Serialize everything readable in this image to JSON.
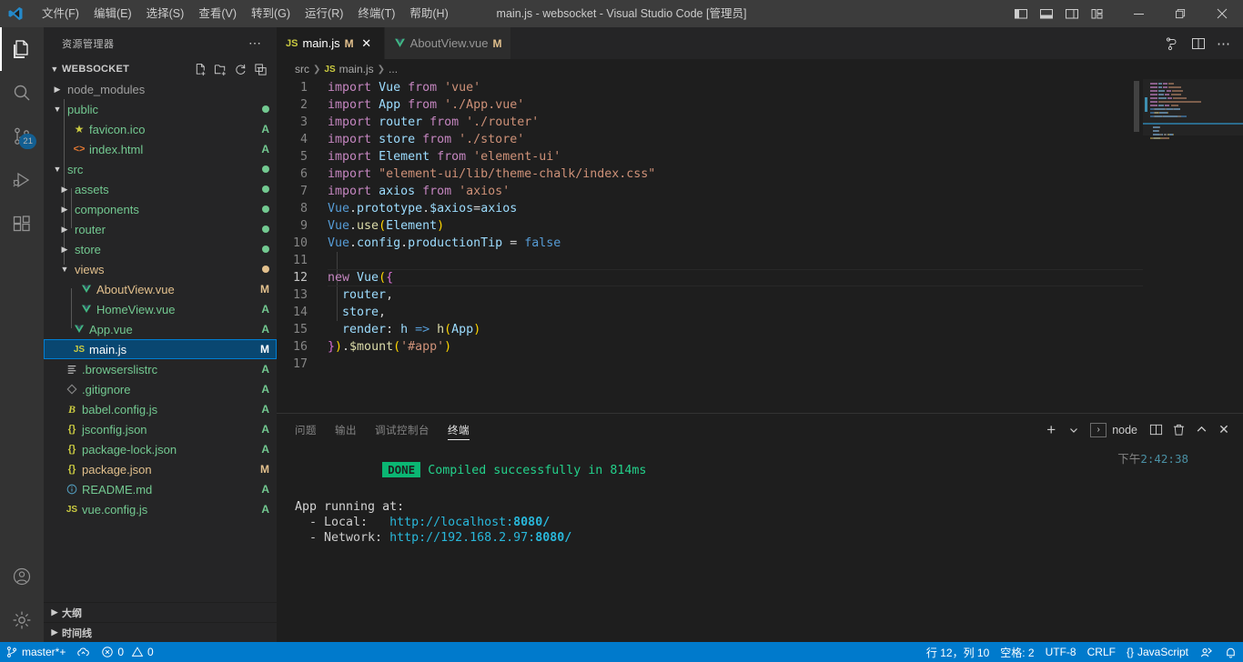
{
  "titlebar": {
    "window_title": "main.js - websocket - Visual Studio Code [管理员]",
    "menu": [
      {
        "label": "文件(F)",
        "name": "menu-file"
      },
      {
        "label": "编辑(E)",
        "name": "menu-edit"
      },
      {
        "label": "选择(S)",
        "name": "menu-selection"
      },
      {
        "label": "查看(V)",
        "name": "menu-view"
      },
      {
        "label": "转到(G)",
        "name": "menu-go"
      },
      {
        "label": "运行(R)",
        "name": "menu-run"
      },
      {
        "label": "终端(T)",
        "name": "menu-terminal"
      },
      {
        "label": "帮助(H)",
        "name": "menu-help"
      }
    ],
    "window_controls": {
      "minimize": "—",
      "maximize": "❐",
      "close": "✕"
    }
  },
  "activitybar": {
    "items": [
      {
        "name": "explorer",
        "icon": "files-icon",
        "active": true,
        "badge": ""
      },
      {
        "name": "search",
        "icon": "search-icon",
        "active": false,
        "badge": ""
      },
      {
        "name": "source-control",
        "icon": "source-control-icon",
        "active": false,
        "badge": "21"
      },
      {
        "name": "run-debug",
        "icon": "run-debug-icon",
        "active": false,
        "badge": ""
      },
      {
        "name": "extensions",
        "icon": "extensions-icon",
        "active": false,
        "badge": ""
      }
    ],
    "bottom": [
      {
        "name": "account",
        "icon": "account-icon"
      },
      {
        "name": "settings",
        "icon": "gear-icon"
      }
    ]
  },
  "sidebar": {
    "title": "资源管理器",
    "more_label": "⋯",
    "project": {
      "name": "WEBSOCKET",
      "actions": [
        "new-file-icon",
        "new-folder-icon",
        "refresh-icon",
        "collapse-all-icon"
      ]
    },
    "files": [
      {
        "label": "node_modules",
        "type": "folder",
        "expanded": false,
        "depth": 0,
        "status": "",
        "color": "grey"
      },
      {
        "label": "public",
        "type": "folder",
        "expanded": true,
        "depth": 0,
        "status": "",
        "color": "green",
        "dot": "#73c991"
      },
      {
        "label": "favicon.ico",
        "type": "file",
        "icon": "star-icon",
        "depth": 1,
        "status": "A",
        "color": "green"
      },
      {
        "label": "index.html",
        "type": "file",
        "icon": "html-icon",
        "depth": 1,
        "status": "A",
        "color": "green"
      },
      {
        "label": "src",
        "type": "folder",
        "expanded": true,
        "depth": 0,
        "status": "",
        "color": "green",
        "dot": "#73c991"
      },
      {
        "label": "assets",
        "type": "folder",
        "expanded": false,
        "depth": 1,
        "status": "",
        "color": "green",
        "dot": "#73c991"
      },
      {
        "label": "components",
        "type": "folder",
        "expanded": false,
        "depth": 1,
        "status": "",
        "color": "green",
        "dot": "#73c991"
      },
      {
        "label": "router",
        "type": "folder",
        "expanded": false,
        "depth": 1,
        "status": "",
        "color": "green",
        "dot": "#73c991"
      },
      {
        "label": "store",
        "type": "folder",
        "expanded": false,
        "depth": 1,
        "status": "",
        "color": "green",
        "dot": "#73c991"
      },
      {
        "label": "views",
        "type": "folder",
        "expanded": true,
        "depth": 1,
        "status": "",
        "color": "orange",
        "dot": "#e2c08d"
      },
      {
        "label": "AboutView.vue",
        "type": "file",
        "icon": "vue-icon",
        "depth": 2,
        "status": "M",
        "color": "orange"
      },
      {
        "label": "HomeView.vue",
        "type": "file",
        "icon": "vue-icon",
        "depth": 2,
        "status": "A",
        "color": "green"
      },
      {
        "label": "App.vue",
        "type": "file",
        "icon": "vue-icon",
        "depth": 1,
        "status": "A",
        "color": "green"
      },
      {
        "label": "main.js",
        "type": "file",
        "icon": "js-icon",
        "depth": 1,
        "status": "M",
        "color": "selected",
        "selected": true
      },
      {
        "label": ".browserslistrc",
        "type": "file",
        "icon": "list-icon",
        "depth": 0,
        "status": "A",
        "color": "green"
      },
      {
        "label": ".gitignore",
        "type": "file",
        "icon": "git-icon",
        "depth": 0,
        "status": "A",
        "color": "green"
      },
      {
        "label": "babel.config.js",
        "type": "file",
        "icon": "babel-icon",
        "depth": 0,
        "status": "A",
        "color": "green"
      },
      {
        "label": "jsconfig.json",
        "type": "file",
        "icon": "json-icon",
        "depth": 0,
        "status": "A",
        "color": "green"
      },
      {
        "label": "package-lock.json",
        "type": "file",
        "icon": "json-icon",
        "depth": 0,
        "status": "A",
        "color": "green"
      },
      {
        "label": "package.json",
        "type": "file",
        "icon": "json-icon",
        "depth": 0,
        "status": "M",
        "color": "orange"
      },
      {
        "label": "README.md",
        "type": "file",
        "icon": "info-icon",
        "depth": 0,
        "status": "A",
        "color": "green"
      },
      {
        "label": "vue.config.js",
        "type": "file",
        "icon": "js-icon",
        "depth": 0,
        "status": "A",
        "color": "green"
      }
    ],
    "sections": [
      {
        "label": "大纲",
        "name": "outline-section"
      },
      {
        "label": "时间线",
        "name": "timeline-section"
      }
    ]
  },
  "editor": {
    "tabs": [
      {
        "label": "main.js",
        "icon": "JS",
        "dirty": "M",
        "active": true,
        "close": "✕"
      },
      {
        "label": "AboutView.vue",
        "icon": "V",
        "dirty": "M",
        "active": false,
        "close": ""
      }
    ],
    "actions": [
      "split-vertical-icon",
      "split-editor-icon",
      "more-actions-icon"
    ],
    "breadcrumbs": [
      "src",
      "main.js",
      "..."
    ],
    "lines": [
      {
        "n": "1",
        "tokens": [
          [
            "tok-kw",
            "import"
          ],
          [
            "tok-plain",
            " "
          ],
          [
            "tok-id",
            "Vue"
          ],
          [
            "tok-plain",
            " "
          ],
          [
            "tok-kw",
            "from"
          ],
          [
            "tok-plain",
            " "
          ],
          [
            "tok-str",
            "'vue'"
          ]
        ]
      },
      {
        "n": "2",
        "tokens": [
          [
            "tok-kw",
            "import"
          ],
          [
            "tok-plain",
            " "
          ],
          [
            "tok-id",
            "App"
          ],
          [
            "tok-plain",
            " "
          ],
          [
            "tok-kw",
            "from"
          ],
          [
            "tok-plain",
            " "
          ],
          [
            "tok-str",
            "'./App.vue'"
          ]
        ]
      },
      {
        "n": "3",
        "tokens": [
          [
            "tok-kw",
            "import"
          ],
          [
            "tok-plain",
            " "
          ],
          [
            "tok-id",
            "router"
          ],
          [
            "tok-plain",
            " "
          ],
          [
            "tok-kw",
            "from"
          ],
          [
            "tok-plain",
            " "
          ],
          [
            "tok-str",
            "'./router'"
          ]
        ]
      },
      {
        "n": "4",
        "tokens": [
          [
            "tok-kw",
            "import"
          ],
          [
            "tok-plain",
            " "
          ],
          [
            "tok-id",
            "store"
          ],
          [
            "tok-plain",
            " "
          ],
          [
            "tok-kw",
            "from"
          ],
          [
            "tok-plain",
            " "
          ],
          [
            "tok-str",
            "'./store'"
          ]
        ]
      },
      {
        "n": "5",
        "tokens": [
          [
            "tok-kw",
            "import"
          ],
          [
            "tok-plain",
            " "
          ],
          [
            "tok-id",
            "Element"
          ],
          [
            "tok-plain",
            " "
          ],
          [
            "tok-kw",
            "from"
          ],
          [
            "tok-plain",
            " "
          ],
          [
            "tok-str",
            "'element-ui'"
          ]
        ]
      },
      {
        "n": "6",
        "tokens": [
          [
            "tok-kw",
            "import"
          ],
          [
            "tok-plain",
            " "
          ],
          [
            "tok-str",
            "\"element-ui/lib/theme-chalk/index.css\""
          ]
        ]
      },
      {
        "n": "7",
        "tokens": [
          [
            "tok-kw",
            "import"
          ],
          [
            "tok-plain",
            " "
          ],
          [
            "tok-id",
            "axios"
          ],
          [
            "tok-plain",
            " "
          ],
          [
            "tok-kw",
            "from"
          ],
          [
            "tok-plain",
            " "
          ],
          [
            "tok-str",
            "'axios'"
          ]
        ]
      },
      {
        "n": "8",
        "tokens": [
          [
            "tok-const",
            "Vue"
          ],
          [
            "tok-plain",
            "."
          ],
          [
            "tok-id",
            "prototype"
          ],
          [
            "tok-plain",
            "."
          ],
          [
            "tok-id",
            "$axios"
          ],
          [
            "tok-plain",
            "="
          ],
          [
            "tok-id",
            "axios"
          ]
        ]
      },
      {
        "n": "9",
        "tokens": [
          [
            "tok-const",
            "Vue"
          ],
          [
            "tok-plain",
            "."
          ],
          [
            "tok-fn",
            "use"
          ],
          [
            "tok-br1",
            "("
          ],
          [
            "tok-id",
            "Element"
          ],
          [
            "tok-br1",
            ")"
          ]
        ]
      },
      {
        "n": "10",
        "tokens": [
          [
            "tok-const",
            "Vue"
          ],
          [
            "tok-plain",
            "."
          ],
          [
            "tok-id",
            "config"
          ],
          [
            "tok-plain",
            "."
          ],
          [
            "tok-id",
            "productionTip"
          ],
          [
            "tok-plain",
            " = "
          ],
          [
            "tok-const",
            "false"
          ]
        ]
      },
      {
        "n": "11",
        "tokens": []
      },
      {
        "n": "12",
        "active": true,
        "tokens": [
          [
            "tok-kw",
            "new"
          ],
          [
            "tok-plain",
            " "
          ],
          [
            "tok-id",
            "Vue"
          ],
          [
            "tok-br1",
            "("
          ],
          [
            "tok-br2",
            "{"
          ]
        ]
      },
      {
        "n": "13",
        "tokens": [
          [
            "tok-plain",
            "  "
          ],
          [
            "tok-id",
            "router"
          ],
          [
            "tok-plain",
            ","
          ]
        ]
      },
      {
        "n": "14",
        "tokens": [
          [
            "tok-plain",
            "  "
          ],
          [
            "tok-id",
            "store"
          ],
          [
            "tok-plain",
            ","
          ]
        ]
      },
      {
        "n": "15",
        "tokens": [
          [
            "tok-plain",
            "  "
          ],
          [
            "tok-id",
            "render"
          ],
          [
            "tok-plain",
            ": "
          ],
          [
            "tok-id",
            "h"
          ],
          [
            "tok-plain",
            " "
          ],
          [
            "tok-arrow",
            "=>"
          ],
          [
            "tok-plain",
            " "
          ],
          [
            "tok-fn",
            "h"
          ],
          [
            "tok-br1",
            "("
          ],
          [
            "tok-id",
            "App"
          ],
          [
            "tok-br1",
            ")"
          ]
        ]
      },
      {
        "n": "16",
        "tokens": [
          [
            "tok-br2",
            "}"
          ],
          [
            "tok-br1",
            ")"
          ],
          [
            "tok-plain",
            "."
          ],
          [
            "tok-fn",
            "$mount"
          ],
          [
            "tok-br1",
            "("
          ],
          [
            "tok-str",
            "'#app'"
          ],
          [
            "tok-br1",
            ")"
          ]
        ]
      },
      {
        "n": "17",
        "tokens": []
      }
    ]
  },
  "panel": {
    "tabs": [
      {
        "label": "问题",
        "name": "tab-problems",
        "active": false
      },
      {
        "label": "输出",
        "name": "tab-output",
        "active": false
      },
      {
        "label": "调试控制台",
        "name": "tab-debug-console",
        "active": false
      },
      {
        "label": "终端",
        "name": "tab-terminal",
        "active": true
      }
    ],
    "toolbar": {
      "new_terminal": "+",
      "dropdown": "⌄",
      "shell_name": "node",
      "shell_icon": "〉",
      "split": "split-terminal-icon",
      "kill": "trash-icon",
      "maximize": "chevron-up-icon",
      "close": "✕"
    },
    "terminal": {
      "done_badge": "DONE",
      "compiled_message": "Compiled successfully in 814ms",
      "timestamp_prefix": "下午",
      "timestamp": "2:42:38",
      "app_running_label": "App running at:",
      "local_label": "  - Local:   ",
      "local_url_base": "http://localhost:",
      "local_port": "8080/",
      "network_label": "  - Network: ",
      "network_url_base": "http://192.168.2.97:",
      "network_port": "8080/"
    }
  },
  "statusbar": {
    "branch": "master*+",
    "sync_icon": "sync-cloud-icon",
    "errors": "0",
    "warnings": "0",
    "cursor": "行 12，列 10",
    "indent": "空格: 2",
    "encoding": "UTF-8",
    "eol": "CRLF",
    "language": "JavaScript",
    "language_icon": "{}",
    "feedback_icon": "feedback-icon",
    "bell_icon": "bell-icon"
  },
  "colors": {
    "accent": "#007acc",
    "selected_row": "#094771",
    "editor_bg": "#1e1e1e",
    "sidebar_bg": "#252526",
    "titlebar_bg": "#3c3c3c",
    "added": "#73c991",
    "modified": "#e2c08d",
    "done_badge": "#0bb673"
  }
}
